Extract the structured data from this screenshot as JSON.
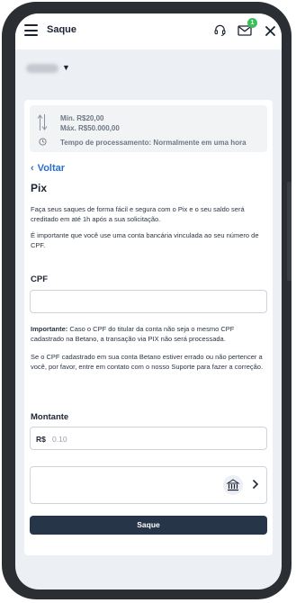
{
  "header": {
    "title": "Saque",
    "notification_count": "1"
  },
  "limits": {
    "min": "Mín. R$20,00",
    "max": "Máx. R$50.000,00",
    "processing": "Tempo de processamento: Normalmente em uma hora"
  },
  "nav": {
    "back_label": "Voltar"
  },
  "method": {
    "title": "Pix",
    "intro": "Faça seus saques de forma fácil e segura com o Pix e o seu saldo será creditado em até 1h após a sua solicitação.",
    "notice": "É importante que você use uma conta bancária vinculada ao seu número de CPF."
  },
  "cpf": {
    "label": "CPF",
    "value": "",
    "warning_strong": "Importante:",
    "warning_text": " Caso o CPF do titular da conta não seja o mesmo CPF cadastrado na Betano, a transação via PIX não será processada.",
    "support_text": "Se o CPF cadastrado em sua conta Betano estiver errado ou não pertencer a você, por favor, entre em contato com o nosso Suporte para fazer a correção."
  },
  "amount": {
    "label": "Montante",
    "currency": "R$",
    "placeholder": "0.10"
  },
  "submit_label": "Saque",
  "icons": {
    "menu": "hamburger-menu-icon",
    "support": "headset-icon",
    "messages": "envelope-icon",
    "close": "close-icon",
    "limits": "up-down-arrows-icon",
    "time": "clock-icon",
    "bank": "bank-icon",
    "next": "chevron-right-icon"
  },
  "colors": {
    "accent": "#2a6fcf",
    "button": "#273548",
    "badge": "#3bbf5a"
  }
}
